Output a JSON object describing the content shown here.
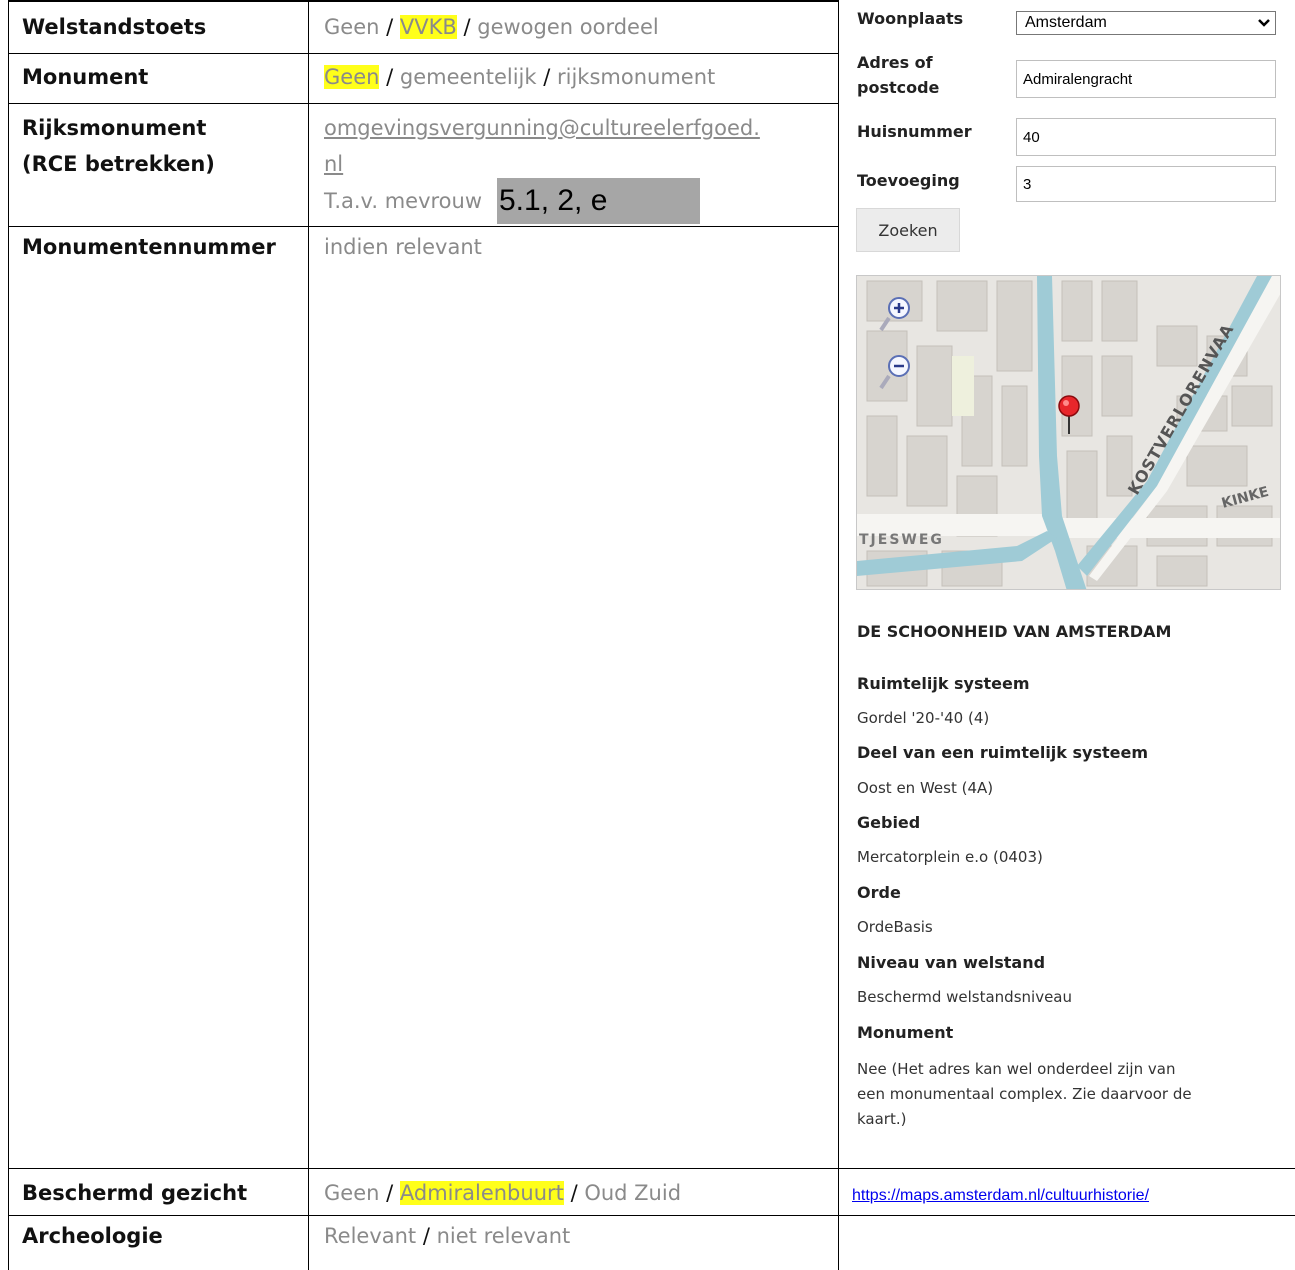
{
  "rows": [
    {
      "label": "Welstandstoets",
      "options": [
        "Geen",
        "VVKB",
        "gewogen oordeel"
      ],
      "selected": "VVKB"
    },
    {
      "label": "Monument",
      "options": [
        "Geen",
        "gemeentelijk",
        "rijksmonument"
      ],
      "selected": "Geen"
    },
    {
      "label_line1": "Rijksmonument",
      "label_line2": "(RCE betrekken)",
      "email_line1": "omgevingsvergunning@cultureelerfgoed.",
      "email_line2": "nl",
      "tav": "T.a.v. mevrouw",
      "redaction": "5.1, 2, e"
    },
    {
      "label": "Monumentennummer",
      "value": "indien relevant"
    },
    {
      "label": "Beschermd gezicht",
      "options": [
        "Geen",
        "Admiralenbuurt",
        "Oud Zuid"
      ],
      "selected": "Admiralenbuurt"
    },
    {
      "label": "Archeologie",
      "options": [
        "Relevant",
        "niet relevant"
      ]
    }
  ],
  "separator": " / ",
  "panel": {
    "woonplaats_label": "Woonplaats",
    "woonplaats_value": "Amsterdam",
    "adres_label_line1": "Adres of",
    "adres_label_line2": "postcode",
    "adres_value": "Admiralengracht",
    "huisnummer_label": "Huisnummer",
    "huisnummer_value": "40",
    "toevoeging_label": "Toevoeging",
    "toevoeging_value": "3",
    "search_button": "Zoeken",
    "map": {
      "street_labels": [
        "KOSTVERLORENVAA",
        "KINKE",
        "TJESWEG"
      ],
      "zoom_in_icon": "zoom-in-icon",
      "zoom_out_icon": "zoom-out-icon",
      "marker_icon": "map-marker-icon",
      "water_color": "#9fcbd6"
    },
    "section_title": "DE SCHOONHEID VAN AMSTERDAM",
    "info": [
      {
        "heading": "Ruimtelijk systeem",
        "value": "Gordel '20-'40 (4)"
      },
      {
        "heading": "Deel van een ruimtelijk systeem",
        "value": "Oost en West (4A)"
      },
      {
        "heading": "Gebied",
        "value": "Mercatorplein e.o (0403)"
      },
      {
        "heading": "Orde",
        "value": "OrdeBasis"
      },
      {
        "heading": "Niveau van welstand",
        "value": "Beschermd welstandsniveau"
      },
      {
        "heading": "Monument",
        "value_line1": "Nee (Het adres kan wel onderdeel zijn van",
        "value_line2": "een monumentaal complex. Zie daarvoor de",
        "value_line3": "kaart.)"
      }
    ],
    "link": "https://maps.amsterdam.nl/cultuurhistorie/"
  },
  "colors": {
    "highlight": "#ffff1a",
    "value_text": "#8a8a8a",
    "redaction": "#a6a6a6"
  }
}
